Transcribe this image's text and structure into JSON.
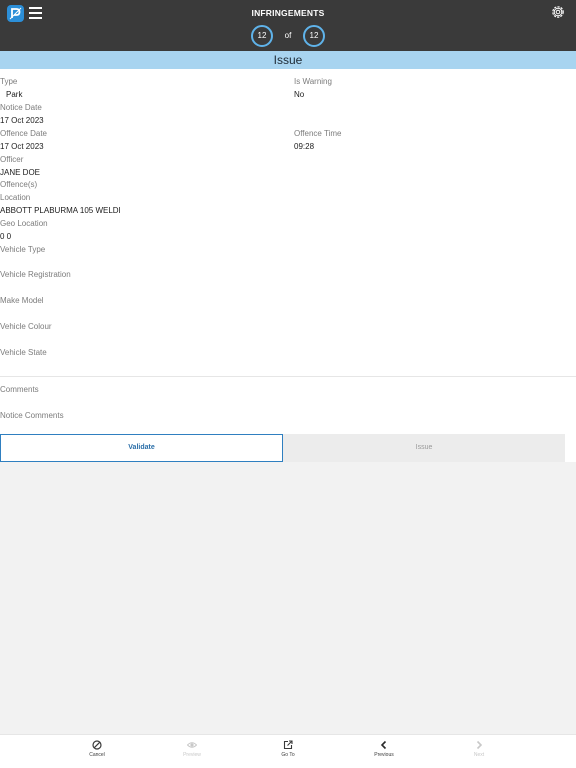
{
  "header": {
    "title": "INFRINGEMENTS",
    "current": "12",
    "of": "of",
    "total": "12"
  },
  "section": {
    "title": "Issue"
  },
  "fields": {
    "type": {
      "label": "Type",
      "value": "Park"
    },
    "is_warning": {
      "label": "Is Warning",
      "value": "No"
    },
    "notice_date": {
      "label": "Notice Date",
      "value": "17 Oct 2023"
    },
    "offence_date": {
      "label": "Offence Date",
      "value": "17 Oct 2023"
    },
    "offence_time": {
      "label": "Offence Time",
      "value": "09:28"
    },
    "officer": {
      "label": "Officer",
      "value": "JANE DOE"
    },
    "offences": {
      "label": "Offence(s)"
    },
    "location": {
      "label": "Location",
      "value": "ABBOTT PLABURMA 105 WELDI"
    },
    "geo_location": {
      "label": "Geo Location",
      "value": "0 0"
    },
    "vehicle_type": {
      "label": "Vehicle Type"
    },
    "vehicle_registration": {
      "label": "Vehicle Registration"
    },
    "make_model": {
      "label": "Make Model"
    },
    "vehicle_colour": {
      "label": "Vehicle Colour"
    },
    "vehicle_state": {
      "label": "Vehicle State"
    },
    "comments": {
      "label": "Comments"
    },
    "notice_comments": {
      "label": "Notice Comments"
    }
  },
  "actions": {
    "validate": "Validate",
    "issue": "Issue"
  },
  "toolbar": {
    "cancel": "Cancel",
    "preview": "Preview",
    "goto": "Go To",
    "previous": "Previous",
    "next": "Next"
  },
  "icons": {
    "logo": "app-logo-icon",
    "menu": "hamburger-menu-icon",
    "settings": "gear-icon",
    "cancel": "cancel-circle-icon",
    "preview": "eye-icon",
    "goto": "external-link-icon",
    "previous": "chevron-left-icon",
    "next": "chevron-right-icon"
  },
  "colors": {
    "header_bg": "#3a3a3a",
    "accent": "#5fb3ea",
    "section_bg": "#a8d4f0",
    "validate_border": "#2f7fc0"
  }
}
